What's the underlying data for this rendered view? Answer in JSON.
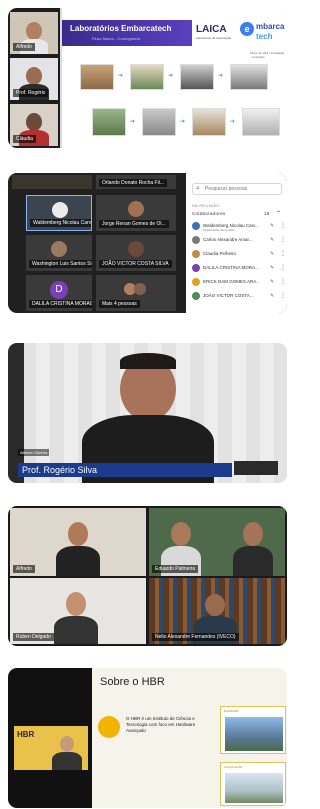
{
  "strip1": {
    "slide_title": "Laboratórios Embarcatech",
    "slide_subtitle": "Fluxo Macro - Cronograma",
    "logo_laica": "LAICA",
    "logo_laica_sub": "Laboratório de Automação",
    "logo_embarca_line1": "mbarca",
    "logo_embarca_line2": "tech",
    "flow_note": "Fluxo de obra / instalação - concluído",
    "participants": [
      {
        "name": "Alfredo"
      },
      {
        "name": "Prof. Rogério"
      },
      {
        "name": "Cláudia"
      }
    ]
  },
  "strip2": {
    "search_placeholder": "Pesquisar pessoas",
    "section_label": "NA REUNIÃO",
    "collaborators_label": "Colaboradores",
    "collaborators_count": "16",
    "people": [
      {
        "name": "Waldemberg Nicolau Carv...",
        "sub": "Organizador da reunião",
        "color": "#3d6fb6"
      },
      {
        "name": "Carlos Alexandre Amar...",
        "sub": "",
        "color": "#7a7a7a"
      },
      {
        "name": "Claudia Pinheiro",
        "sub": "",
        "color": "#c08a4a"
      },
      {
        "name": "DALILA CRISTINA MORA...",
        "sub": "",
        "color": "#7b3fb5"
      },
      {
        "name": "ERICK DAM GOMES ARA...",
        "sub": "",
        "color": "#e0a020"
      },
      {
        "name": "JOÃO VICTOR COSTA...",
        "sub": "",
        "color": "#4b8d5a"
      }
    ],
    "tiles": [
      {
        "name": "Orlando Donato Rocha Fil..."
      },
      {
        "name": "Waldemberg Nicolau Carv..."
      },
      {
        "name": "Jorge Renan Gomes de Ol..."
      },
      {
        "name": "Washington Luis Santos Si..."
      },
      {
        "name": "JOÃO VICTOR COSTA SILVA"
      },
      {
        "name": "DALILA CRISTINA MORAIS..."
      },
      {
        "name": "Mais 4 pessoas"
      }
    ],
    "dalila_initial": "D"
  },
  "strip3": {
    "lower_third": "Prof. Rogério Silva",
    "tile_tag": "Alfredo Oliveira"
  },
  "strip4": {
    "tiles": [
      {
        "name": "Alfredo"
      },
      {
        "name": "Eduardo Palmeira"
      },
      {
        "name": "Ruben Delgado"
      },
      {
        "name": "Nelio Alexandre Fernandes (IVECO)"
      }
    ]
  },
  "strip5": {
    "title": "Sobre o HBR",
    "description": "O HBR é um Instituto de Ciência e Tecnologia com foco em Hardware Avançado",
    "card1_caption": "Brasília/DF",
    "card2_caption": "Campinas/SP",
    "event_badge": "HBR"
  }
}
